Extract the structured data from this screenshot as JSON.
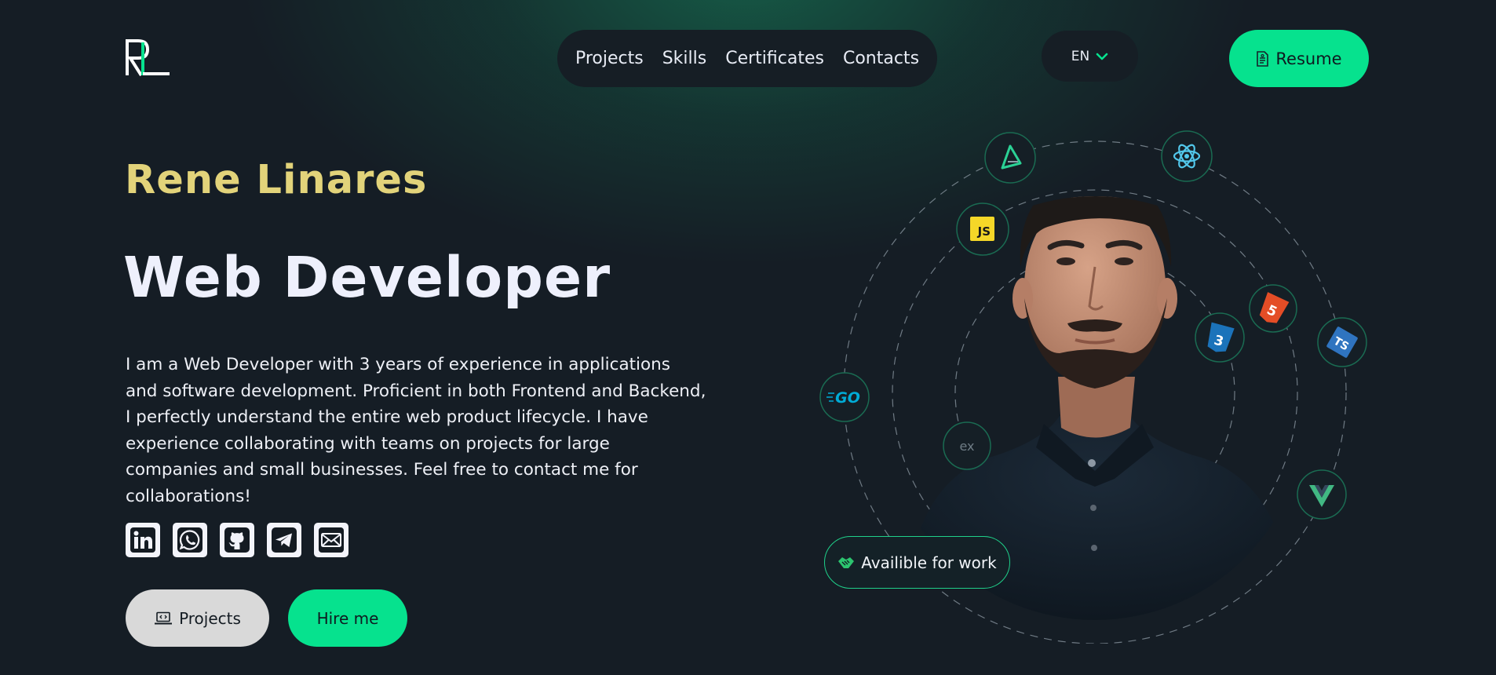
{
  "logo": {
    "text": "RL"
  },
  "nav": {
    "items": [
      {
        "label": "Projects"
      },
      {
        "label": "Skills"
      },
      {
        "label": "Certificates"
      },
      {
        "label": "Contacts"
      }
    ]
  },
  "language": {
    "selected": "EN"
  },
  "header": {
    "resume_label": "Resume"
  },
  "hero": {
    "name": "Rene Linares",
    "role": "Web Developer",
    "bio": "I am a Web Developer with 3 years of experience in applications and software development. Proficient in both Frontend and Backend, I perfectly understand the entire web product lifecycle. I have experience collaborating with teams on projects for large companies and small businesses. Feel free to contact me for collaborations!",
    "projects_label": "Projects",
    "hire_label": "Hire me",
    "availability": "Availible for work"
  },
  "socials": [
    {
      "icon": "linkedin-icon"
    },
    {
      "icon": "whatsapp-icon"
    },
    {
      "icon": "github-icon"
    },
    {
      "icon": "telegram-icon"
    },
    {
      "icon": "mail-icon"
    }
  ],
  "tech_icons": [
    {
      "icon": "astro-icon"
    },
    {
      "icon": "react-icon",
      "color": "#52c7ea"
    },
    {
      "icon": "javascript-icon",
      "label": "JS",
      "color": "#f5d728"
    },
    {
      "icon": "html5-icon",
      "label": "5",
      "color": "#e44d26"
    },
    {
      "icon": "css3-icon",
      "label": "3",
      "color": "#1b73ba"
    },
    {
      "icon": "typescript-icon",
      "label": "TS",
      "color": "#2f74c0"
    },
    {
      "icon": "go-icon",
      "label": "GO",
      "color": "#00acd7"
    },
    {
      "icon": "express-icon",
      "label": "ex"
    },
    {
      "icon": "vue-icon",
      "color": "#41b883"
    }
  ],
  "colors": {
    "background": "#151d25",
    "accent": "#06e28e",
    "name": "#e2d37a",
    "text": "#eef0fc"
  }
}
